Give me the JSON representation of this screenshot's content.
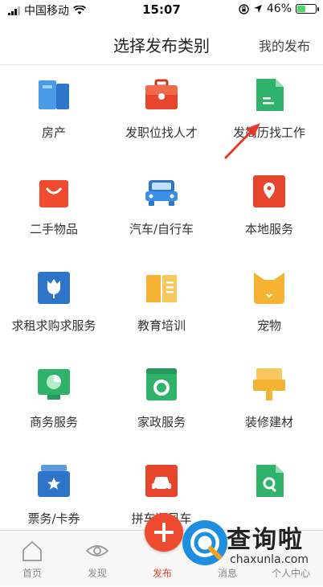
{
  "status_bar": {
    "carrier": "中国移动",
    "time": "15:07",
    "battery_percent": "46%",
    "battery_level": 0.46
  },
  "header": {
    "title": "选择发布类别",
    "my_posts": "我的发布"
  },
  "categories": [
    {
      "label": "房产",
      "icon": "building-icon",
      "color": "#3a8ee6"
    },
    {
      "label": "发职位找人才",
      "icon": "briefcase-icon",
      "color": "#e8452d"
    },
    {
      "label": "发简历找工作",
      "icon": "document-icon",
      "color": "#2fb36b"
    },
    {
      "label": "二手物品",
      "icon": "shopping-bag-icon",
      "color": "#f04a2f"
    },
    {
      "label": "汽车/自行车",
      "icon": "car-icon",
      "color": "#3a8ee6"
    },
    {
      "label": "本地服务",
      "icon": "location-pin-icon",
      "color": "#e8452d"
    },
    {
      "label": "求租求购求服务",
      "icon": "tulip-icon",
      "color": "#2e74c9"
    },
    {
      "label": "教育培训",
      "icon": "book-icon",
      "color": "#f6b233"
    },
    {
      "label": "宠物",
      "icon": "cat-icon",
      "color": "#f6b233"
    },
    {
      "label": "商务服务",
      "icon": "pie-chart-icon",
      "color": "#2fb36b"
    },
    {
      "label": "家政服务",
      "icon": "washing-machine-icon",
      "color": "#2fb36b"
    },
    {
      "label": "装修建材",
      "icon": "brush-icon",
      "color": "#f6b233"
    },
    {
      "label": "票务/卡券",
      "icon": "ticket-icon",
      "color": "#2e74c9"
    },
    {
      "label": "拼车顺风车",
      "icon": "carpool-icon",
      "color": "#e8452d"
    },
    {
      "label": "",
      "icon": "search-doc-icon",
      "color": "#2fb36b"
    }
  ],
  "tabs": [
    {
      "label": "首页",
      "icon": "home-icon"
    },
    {
      "label": "发现",
      "icon": "eye-icon"
    },
    {
      "label": "发布",
      "icon": "plus-icon"
    },
    {
      "label": "消息",
      "icon": "message-icon"
    },
    {
      "label": "个人中心",
      "icon": "person-icon"
    }
  ],
  "watermark": {
    "name": "查询啦",
    "domain": "chaxunla.com"
  }
}
